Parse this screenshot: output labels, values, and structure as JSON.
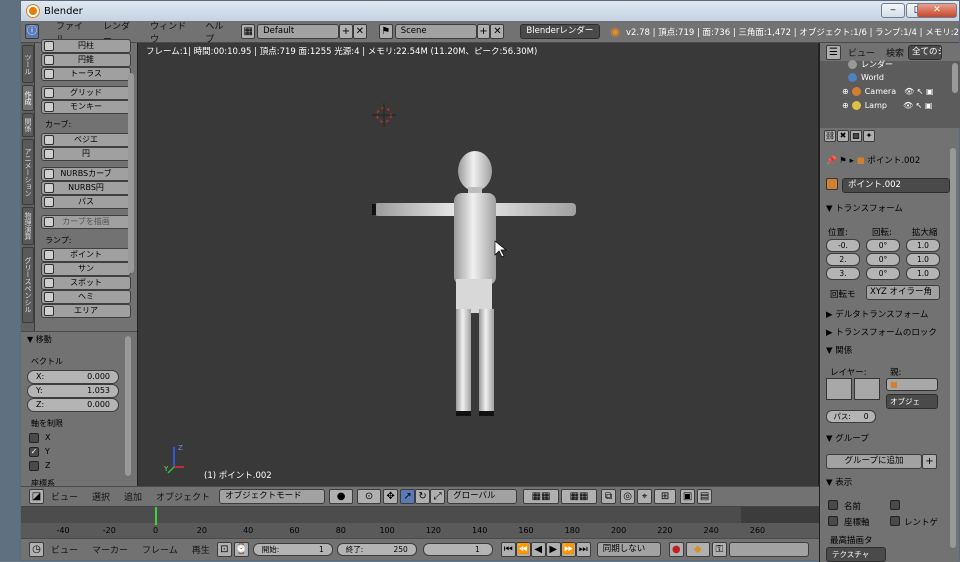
{
  "window": {
    "title": "Blender",
    "min": "‒",
    "max": "□",
    "close": "✕"
  },
  "menu": [
    "ファイル",
    "レンダー",
    "ウィンドウ",
    "ヘルプ"
  ],
  "header": {
    "layout": "Default",
    "scene": "Scene",
    "engine": "Blenderレンダー",
    "stats": "v2.78 | 頂点:719 | 面:736 | 三角面:1,472 | オブジェクト:1/6 | ランプ:1/4 | メモリ:2"
  },
  "tabs": [
    "ツール",
    "作成",
    "関係",
    "アニメーション",
    "物理演算",
    "グリースペンシル"
  ],
  "toolshelf": {
    "items_top": [
      "円柱",
      "円錐",
      "トーラス"
    ],
    "items_mid": [
      "グリッド",
      "モンキー"
    ],
    "curve_header": "カーブ:",
    "curve_items": [
      "ベジエ",
      "円",
      "NURBSカーブ",
      "NURBS円",
      "パス",
      "カーブを描画"
    ],
    "lamp_header": "ランプ:",
    "lamp_items": [
      "ポイント",
      "サン",
      "スポット",
      "ヘミ",
      "エリア"
    ]
  },
  "operator": {
    "title": "▼ 移動",
    "vector_label": "ベクトル",
    "x_label": "X:",
    "x_value": "0.000",
    "y_label": "Y:",
    "y_value": "1.053",
    "z_label": "Z:",
    "z_value": "0.000",
    "constraint_label": "軸を制限",
    "axes": [
      "X",
      "Y",
      "Z"
    ],
    "axes_checked": [
      false,
      true,
      false
    ],
    "orient_label": "座標系"
  },
  "viewport": {
    "info": "フレーム:1| 時間:00:10.95 | 頂点:719 面:1255 光源:4 | メモリ:22.54M (11.20M、ピーク:56.30M)",
    "object_label": "(1) ポイント.002"
  },
  "view3d_header": {
    "menus": [
      "ビュー",
      "選択",
      "追加",
      "オブジェクト"
    ],
    "mode": "オブジェクトモード",
    "orientation": "グローバル"
  },
  "timeline": {
    "ticks": [
      "-40",
      "-20",
      "0",
      "20",
      "40",
      "60",
      "80",
      "100",
      "120",
      "140",
      "160",
      "180",
      "200",
      "220",
      "240",
      "260"
    ],
    "current_frame": 0,
    "menus": [
      "ビュー",
      "マーカー",
      "フレーム",
      "再生"
    ],
    "start_label": "開始:",
    "start_value": "1",
    "end_label": "終了:",
    "end_value": "250",
    "frame_value": "1",
    "sync": "同期しない"
  },
  "outliner": {
    "view": "ビュー",
    "search": "検索",
    "scenes": "全てのシ",
    "items": [
      "レンダー",
      "World",
      "Camera",
      "Lamp"
    ]
  },
  "properties": {
    "breadcrumb": "ポイント.002",
    "object_name": "ポイント.002",
    "transform_header": "▼ トランスフォーム",
    "location_label": "位置:",
    "rotation_label": "回転:",
    "scale_label": "拡大縮",
    "location": [
      "-0.",
      "2.",
      "3."
    ],
    "rotation": [
      "0°",
      "0°",
      "0°"
    ],
    "scale": [
      "1.0",
      "1.0",
      "1.0"
    ],
    "rotmode_label": "回転モ",
    "rotmode_value": "XYZ オイラー角",
    "delta_header": "▶ デルタトランスフォーム",
    "lock_header": "▶ トランスフォームのロック",
    "relations_header": "▼ 関係",
    "layer_label": "レイヤー:",
    "parent_label": "親:",
    "parent_type": "オブジェ",
    "pass_label": "パス:",
    "pass_value": "0",
    "groups_header": "▼ グループ",
    "add_group": "グループに追加",
    "display_header": "▼ 表示",
    "name_label": "名前",
    "axes_label": "座標軸",
    "render_label": "レントゲ",
    "max_draw_label": "最高描画タ",
    "texture_label": "テクスチャ"
  }
}
